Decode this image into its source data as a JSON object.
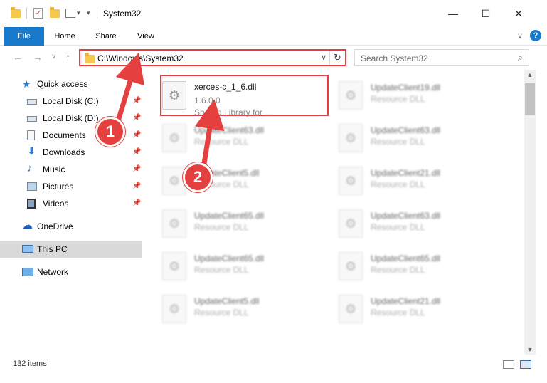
{
  "window": {
    "title": "System32",
    "minimize_glyph": "—",
    "maximize_glyph": "☐",
    "close_glyph": "✕"
  },
  "ribbon": {
    "tabs": [
      {
        "label": "File",
        "active": true
      },
      {
        "label": "Home"
      },
      {
        "label": "Share"
      },
      {
        "label": "View"
      }
    ],
    "help_glyph": "?",
    "expand_glyph": "∨"
  },
  "address": {
    "path": "C:\\Windows\\System32",
    "search_placeholder": "Search System32",
    "back_glyph": "←",
    "forward_glyph": "→",
    "recent_glyph": "∨",
    "up_glyph": "↑",
    "refresh_glyph": "↻",
    "dropdown_glyph": "∨",
    "search_glyph": "⌕"
  },
  "sidebar": {
    "quick_access": "Quick access",
    "items": [
      {
        "label": "Local Disk (C:)",
        "icon": "drive-icon"
      },
      {
        "label": "Local Disk (D:)",
        "icon": "drive-icon"
      },
      {
        "label": "Documents",
        "icon": "documents-icon"
      },
      {
        "label": "Downloads",
        "icon": "downloads-icon"
      },
      {
        "label": "Music",
        "icon": "music-icon"
      },
      {
        "label": "Pictures",
        "icon": "pictures-icon"
      },
      {
        "label": "Videos",
        "icon": "videos-icon"
      }
    ],
    "onedrive": "OneDrive",
    "thispc": "This PC",
    "network": "Network",
    "pin_glyph": "📌"
  },
  "files": {
    "highlighted": {
      "name": "xerces-c_1_6.dll",
      "version": "1.6.0.0",
      "description": "Shared Library for ..."
    },
    "col1": [
      {
        "name": "UpdateClient63.dll",
        "type": "Resource DLL"
      },
      {
        "name": "UpdateClient5.dll",
        "type": "Resource DLL"
      },
      {
        "name": "UpdateClient65.dll",
        "type": "Resource DLL"
      },
      {
        "name": "UpdateClient65.dll",
        "type": "Resource DLL"
      },
      {
        "name": "UpdateClient5.dll",
        "type": "Resource DLL"
      }
    ],
    "col2": [
      {
        "name": "UpdateClient19.dll",
        "type": "Resource DLL"
      },
      {
        "name": "UpdateClient63.dll",
        "type": "Resource DLL"
      },
      {
        "name": "UpdateClient21.dll",
        "type": "Resource DLL"
      },
      {
        "name": "UpdateClient63.dll",
        "type": "Resource DLL"
      },
      {
        "name": "UpdateClient65.dll",
        "type": "Resource DLL"
      },
      {
        "name": "UpdateClient21.dll",
        "type": "Resource DLL"
      }
    ]
  },
  "status": {
    "count": "132 items"
  },
  "callouts": {
    "one": "1",
    "two": "2",
    "color": "#e3403f"
  }
}
